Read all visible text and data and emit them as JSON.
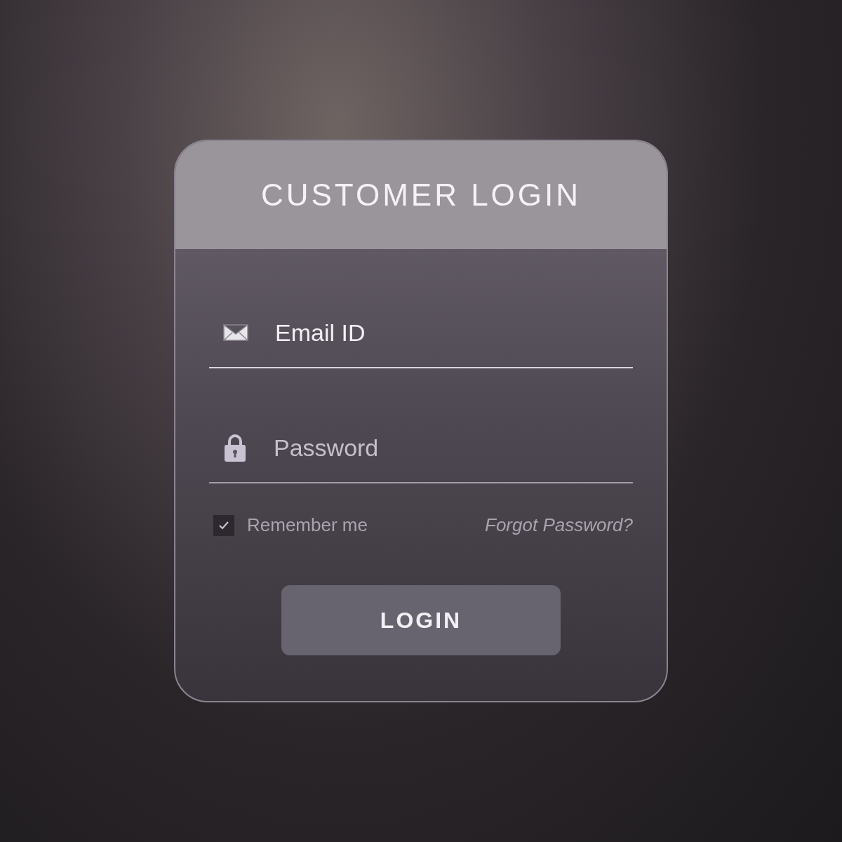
{
  "card": {
    "title": "CUSTOMER LOGIN"
  },
  "fields": [
    {
      "kind": "email",
      "placeholder": "Email ID",
      "focused": true
    },
    {
      "kind": "password",
      "placeholder": "Password",
      "focused": false
    }
  ],
  "remember": {
    "label": "Remember me",
    "checked": true
  },
  "forgot_link": "Forgot Password?",
  "login_button": "LOGIN"
}
